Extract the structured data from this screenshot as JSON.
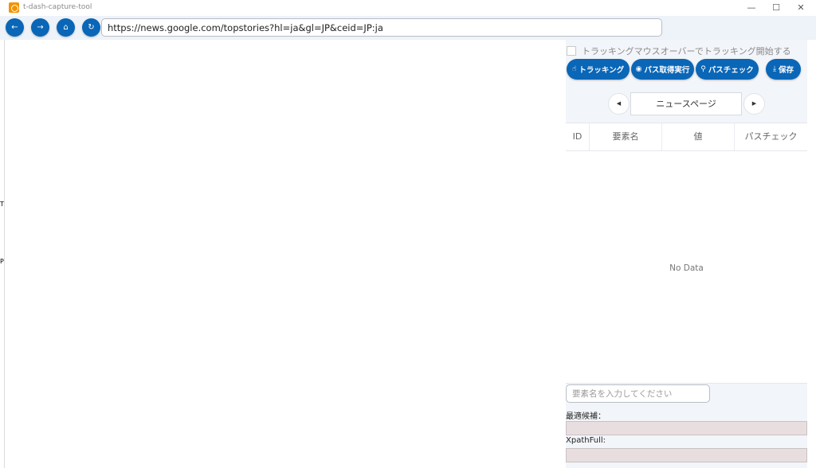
{
  "window": {
    "title": "t-dash-capture-tool",
    "minimize": "—",
    "maximize": "☐",
    "close": "✕"
  },
  "navbar": {
    "back_icon": "←",
    "forward_icon": "→",
    "home_icon": "⌂",
    "reload_icon": "↻",
    "url": "https://news.google.com/topstories?hl=ja&gl=JP&ceid=JP:ja"
  },
  "left_edge": {
    "chars": [
      "T",
      "P"
    ]
  },
  "panel": {
    "tracking_checkbox_label": "トラッキングマウスオーバーでトラッキング開始する",
    "tracking_checked": false,
    "buttons": {
      "tracking": {
        "icon": "☝",
        "label": "トラッキング"
      },
      "path_get": {
        "icon": "◉",
        "label": "パス取得実行"
      },
      "path_check": {
        "icon": "⚲",
        "label": "パスチェック"
      },
      "save": {
        "icon": "⤓",
        "label": "保存"
      }
    },
    "pager": {
      "prev_icon": "◀",
      "next_icon": "▶",
      "page_name": "ニュースページ"
    },
    "table": {
      "columns": [
        "ID",
        "要素名",
        "値",
        "パスチェック"
      ],
      "rows": [],
      "empty_text": "No Data"
    },
    "element_name_placeholder": "要素名を入力してください",
    "best_candidate_label": "最適候補：",
    "best_candidate_value": "",
    "xpath_full_label": "XpathFull:",
    "xpath_full_value": ""
  }
}
